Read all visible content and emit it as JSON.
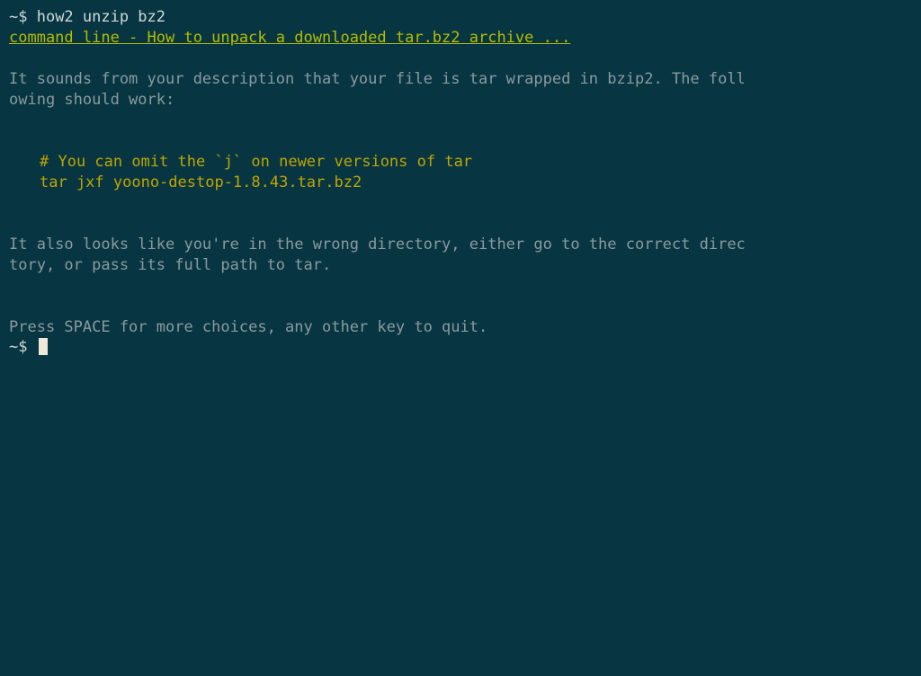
{
  "prompt1": {
    "symbol": "~$ ",
    "command": "how2 unzip bz2"
  },
  "link": "command line - How to unpack a downloaded tar.bz2 archive ...",
  "paragraph1_line1": "It sounds from your description that your file is tar wrapped in bzip2. The foll",
  "paragraph1_line2": "owing should work:",
  "code_line1": "# You can omit the `j` on newer versions of tar",
  "code_line2": "tar jxf yoono-destop-1.8.43.tar.bz2",
  "paragraph2_line1": "It also looks like you're in the wrong directory, either go to the correct direc",
  "paragraph2_line2": "tory, or pass its full path to tar.",
  "footer": "Press SPACE for more choices, any other key to quit.",
  "prompt2": {
    "symbol": "~$ "
  }
}
